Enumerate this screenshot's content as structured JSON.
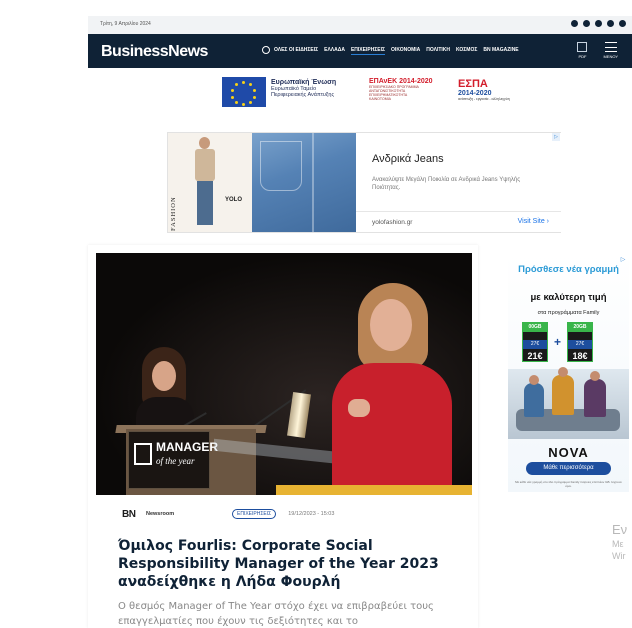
{
  "top_bar": {
    "date": "Τρίτη, 9 Απριλίου 2024",
    "social_icons": [
      "facebook-icon",
      "twitter-icon",
      "linkedin-icon",
      "instagram-icon",
      "rss-icon"
    ]
  },
  "header": {
    "logo": "BusinessNews",
    "nav": [
      {
        "label": "ΟΛΕΣ ΟΙ ΕΙΔΗΣΕΙΣ",
        "active": false
      },
      {
        "label": "ΕΛΛΑΔΑ",
        "active": false
      },
      {
        "label": "ΕΠΙΧΕΙΡΗΣΕΙΣ",
        "active": true
      },
      {
        "label": "ΟΙΚΟΝΟΜΙΑ",
        "active": false
      },
      {
        "label": "ΠΟΛΙΤΙΚΗ",
        "active": false
      },
      {
        "label": "ΚΟΣΜΟΣ",
        "active": false
      },
      {
        "label": "BN MAGAZINE",
        "active": false
      }
    ],
    "pdf_label": "PDF",
    "menu_label": "ΜΕΝΟΥ",
    "colors": {
      "navbar": "#0f2236",
      "accent": "#2a7fd4"
    }
  },
  "espa_banner": {
    "eu_title": "Ευρωπαϊκή Ένωση",
    "eu_line2": "Ευρωπαϊκό Ταμείο",
    "eu_line3": "Περιφερειακής Ανάπτυξης",
    "epanek_title": "ΕΠΑνΕΚ 2014-2020",
    "epanek_l1": "ΕΠΙΧΕΙΡΗΣΙΑΚΟ ΠΡΟΓΡΑΜΜΑ",
    "epanek_l2": "ΑΝΤΑΓΩΝΙΣΤΙΚΟΤΗΤΑ",
    "epanek_l3": "ΕΠΙΧΕΙΡΗΜΑΤΙΚΟΤΗΤΑ",
    "epanek_l4": "ΚΑΙΝΟΤΟΜΙΑ",
    "espa_title": "ΕΣΠΑ",
    "espa_years": "2014-2020",
    "espa_slogan": "ανάπτυξη - εργασία - αλληλεγγύη"
  },
  "ad_jeans": {
    "brand_vertical": "FASHION",
    "yolo": "YOLO",
    "title": "Ανδρικά Jeans",
    "description": "Ανακαλύψτε Μεγάλη Ποικιλία σε Ανδρικά Jeans Υψηλής Ποιότητας.",
    "domain": "yolofashion.gr",
    "visit_label": "Visit Site",
    "ad_marker": "▷"
  },
  "article": {
    "author": "Newsroom",
    "category": "ΕΠΙΧΕΙΡΗΣΕΙΣ",
    "datetime": "19/12/2023 - 15:03",
    "title": "Όμιλος Fourlis: Corporate Social Responsibility Manager of the Year 2023 αναδείχθηκε η Λήδα Φουρλή",
    "summary": "Ο θεσμός Manager of The Year στόχο έχει να επιβραβεύει τους επαγγελματίες που έχουν τις δεξιότητες και το",
    "podium_text": "MANAGER",
    "podium_sub": "of the year",
    "bn_logo": "BN"
  },
  "ad_nova": {
    "line1": "Πρόσθεσε νέα γραμμή",
    "line2": "με καλύτερη τιμή",
    "line3": "στα προγράμματα Family",
    "plans": [
      {
        "tag": "00GB",
        "price_old": "27€",
        "price": "21€"
      },
      {
        "tag": "20GB",
        "price_old": "27€",
        "price": "18€"
      }
    ],
    "brand": "NOVA",
    "cta": "Μάθε περισσότερα",
    "legal": "Με κάθε νέα γραμμή στο ίδιο πρόγραμμα Family παίρνεις επιπλέον GB. Ισχύουν όροι.",
    "ad_marker": "▷"
  },
  "side_teaser": {
    "t1": "Εν",
    "t2": "Με",
    "t3": "Wir"
  }
}
